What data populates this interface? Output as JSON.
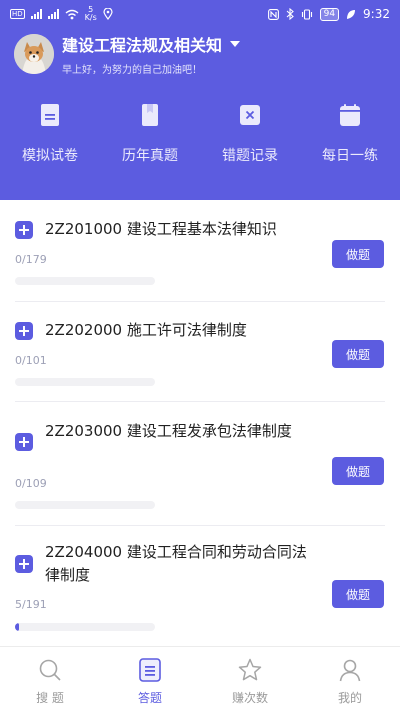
{
  "status_bar": {
    "network_small": "HD",
    "speed_value": "5",
    "speed_unit": "K/s",
    "battery": "94",
    "time": "9:32"
  },
  "header": {
    "title": "建设工程法规及相关知",
    "subtitle": "早上好，为努力的自己加油吧！",
    "accent_color": "#5c5ce0"
  },
  "quick_nav": [
    {
      "label": "模拟试卷",
      "icon": "document-icon"
    },
    {
      "label": "历年真题",
      "icon": "book-icon"
    },
    {
      "label": "错题记录",
      "icon": "error-note-icon"
    },
    {
      "label": "每日一练",
      "icon": "calendar-icon"
    }
  ],
  "chapters": [
    {
      "code": "2Z201000 建设工程基本法律知识",
      "progress_text": "0/179",
      "done": 0,
      "total": 179,
      "button": "做题"
    },
    {
      "code": "2Z202000 施工许可法律制度",
      "progress_text": "0/101",
      "done": 0,
      "total": 101,
      "button": "做题"
    },
    {
      "code": "2Z203000 建设工程发承包法律制度",
      "progress_text": "0/109",
      "done": 0,
      "total": 109,
      "button": "做题"
    },
    {
      "code": "2Z204000 建设工程合同和劳动合同法律制度",
      "progress_text": "5/191",
      "done": 5,
      "total": 191,
      "button": "做题"
    }
  ],
  "bottom_nav": [
    {
      "label": "搜 题",
      "icon": "search-icon",
      "active": false
    },
    {
      "label": "答题",
      "icon": "answer-sheet-icon",
      "active": true
    },
    {
      "label": "赚次数",
      "icon": "star-icon",
      "active": false
    },
    {
      "label": "我的",
      "icon": "user-icon",
      "active": false
    }
  ]
}
